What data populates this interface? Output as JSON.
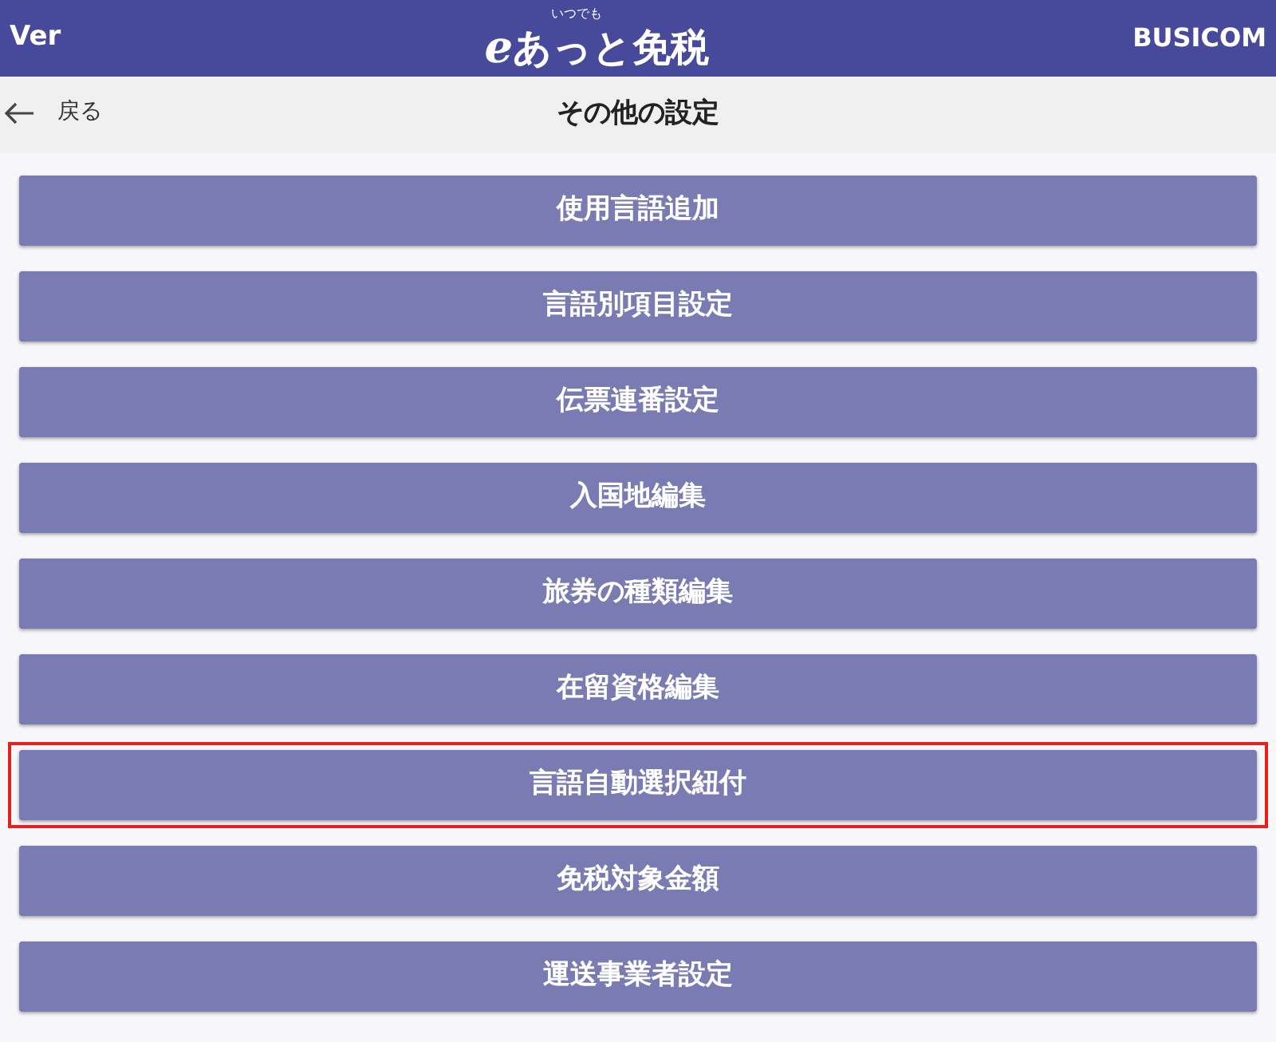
{
  "header": {
    "left": "Ver",
    "logo_prefix": "e",
    "logo": "あっと免税",
    "logo_ruby": "いつでも",
    "right": "BUSICOM"
  },
  "nav": {
    "back": "戻る",
    "title": "その他の設定"
  },
  "buttons": [
    {
      "label": "使用言語追加",
      "highlighted": false
    },
    {
      "label": "言語別項目設定",
      "highlighted": false
    },
    {
      "label": "伝票連番設定",
      "highlighted": false
    },
    {
      "label": "入国地編集",
      "highlighted": false
    },
    {
      "label": "旅券の種類編集",
      "highlighted": false
    },
    {
      "label": "在留資格編集",
      "highlighted": false
    },
    {
      "label": "言語自動選択紐付",
      "highlighted": true
    },
    {
      "label": "免税対象金額",
      "highlighted": false
    },
    {
      "label": "運送事業者設定",
      "highlighted": false
    }
  ]
}
